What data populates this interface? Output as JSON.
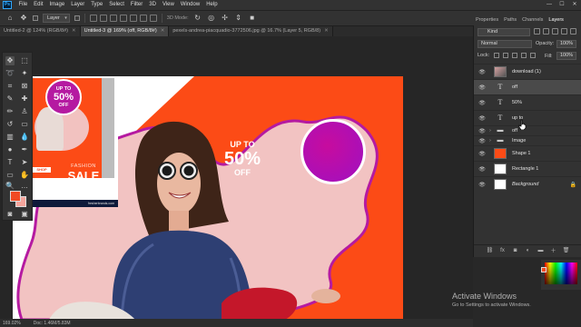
{
  "menubar": {
    "items": [
      "File",
      "Edit",
      "Image",
      "Layer",
      "Type",
      "Select",
      "Filter",
      "3D",
      "View",
      "Window",
      "Help"
    ]
  },
  "options": {
    "auto_select_value": "Layer",
    "mode_3d_label": "3D Mode:"
  },
  "doc_tabs": [
    {
      "label": "Untitled-2 @ 124% (RGB/8#)",
      "active": false
    },
    {
      "label": "Untitled-3 @ 169% (off, RGB/8#)",
      "active": true
    },
    {
      "label": "pexels-andrea-piacquadio-3772506.jpg @ 16.7% (Layer 5, RGB/8)",
      "active": false
    }
  ],
  "panel_tabs": [
    "Properties",
    "Paths",
    "Channels",
    "Layers"
  ],
  "layers_panel": {
    "filter_value": "Kind",
    "blend_mode": "Normal",
    "opacity_label": "Opacity:",
    "opacity_value": "100%",
    "lock_label": "Lock:",
    "fill_label": "Fill:",
    "fill_value": "100%",
    "layers": [
      {
        "name": "download (1)",
        "kind": "image",
        "selected": false
      },
      {
        "name": "off",
        "kind": "text",
        "selected": true
      },
      {
        "name": "50%",
        "kind": "text",
        "selected": false
      },
      {
        "name": "up to",
        "kind": "text",
        "selected": false
      },
      {
        "name": "off",
        "kind": "group",
        "selected": false
      },
      {
        "name": "Image",
        "kind": "group",
        "selected": false
      },
      {
        "name": "Shape 1",
        "kind": "shape",
        "selected": false
      },
      {
        "name": "Rectangle 1",
        "kind": "rect",
        "selected": false
      },
      {
        "name": "Background",
        "kind": "background",
        "selected": false
      }
    ]
  },
  "artwork_main": {
    "up_to": "UP TO",
    "percent": "50%",
    "off": "OFF"
  },
  "artwork_secondary": {
    "up_to": "UP TO",
    "percent": "50%",
    "off": "OFF",
    "fashion": "FASHION",
    "sale": "SALE",
    "shop_now": "SHOP NOW",
    "website": "fresherbrands.com"
  },
  "status": {
    "zoom": "169.02%",
    "doc_info": "Doc: 1.46M/5.83M"
  },
  "watermark": {
    "title": "Activate Windows",
    "subtitle": "Go to Settings to activate Windows."
  },
  "colors": {
    "foreground": "#f04a24",
    "background": "#f4a59c",
    "accent_orange": "#fc4b16",
    "accent_magenta": "#b51aa1"
  }
}
